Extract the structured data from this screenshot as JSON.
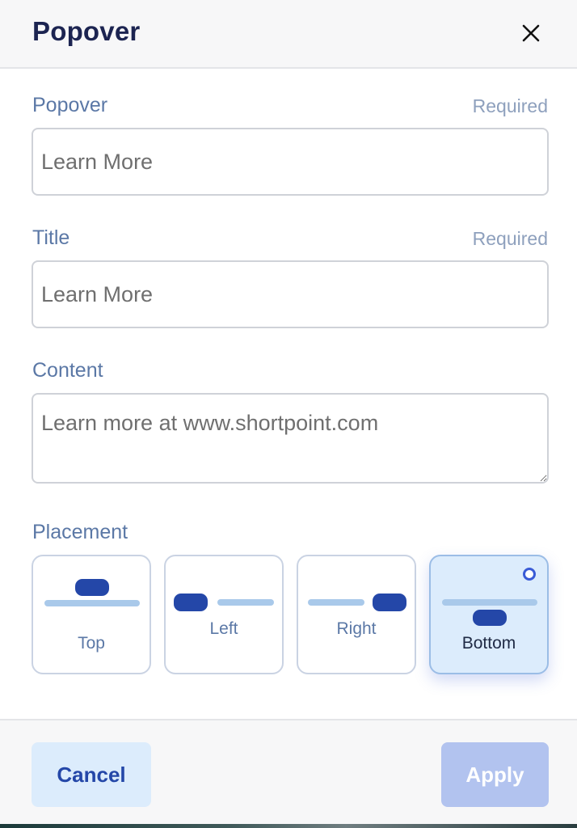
{
  "header": {
    "title": "Popover"
  },
  "fields": {
    "popover": {
      "label": "Popover",
      "required": "Required",
      "value": "Learn More"
    },
    "title": {
      "label": "Title",
      "required": "Required",
      "value": "Learn More"
    },
    "content": {
      "label": "Content",
      "value": "Learn more at www.shortpoint.com"
    }
  },
  "placement": {
    "label": "Placement",
    "selected": "Bottom",
    "options": [
      {
        "label": "Top"
      },
      {
        "label": "Left"
      },
      {
        "label": "Right"
      },
      {
        "label": "Bottom"
      }
    ]
  },
  "footer": {
    "cancel_label": "Cancel",
    "apply_label": "Apply"
  },
  "colors": {
    "title": "#1c2451",
    "label": "#5b78a6",
    "accent": "#2447a8",
    "selected_bg": "#dcecfc",
    "apply_disabled": "#b2c3ef"
  },
  "icons": {
    "close": "close-icon"
  }
}
